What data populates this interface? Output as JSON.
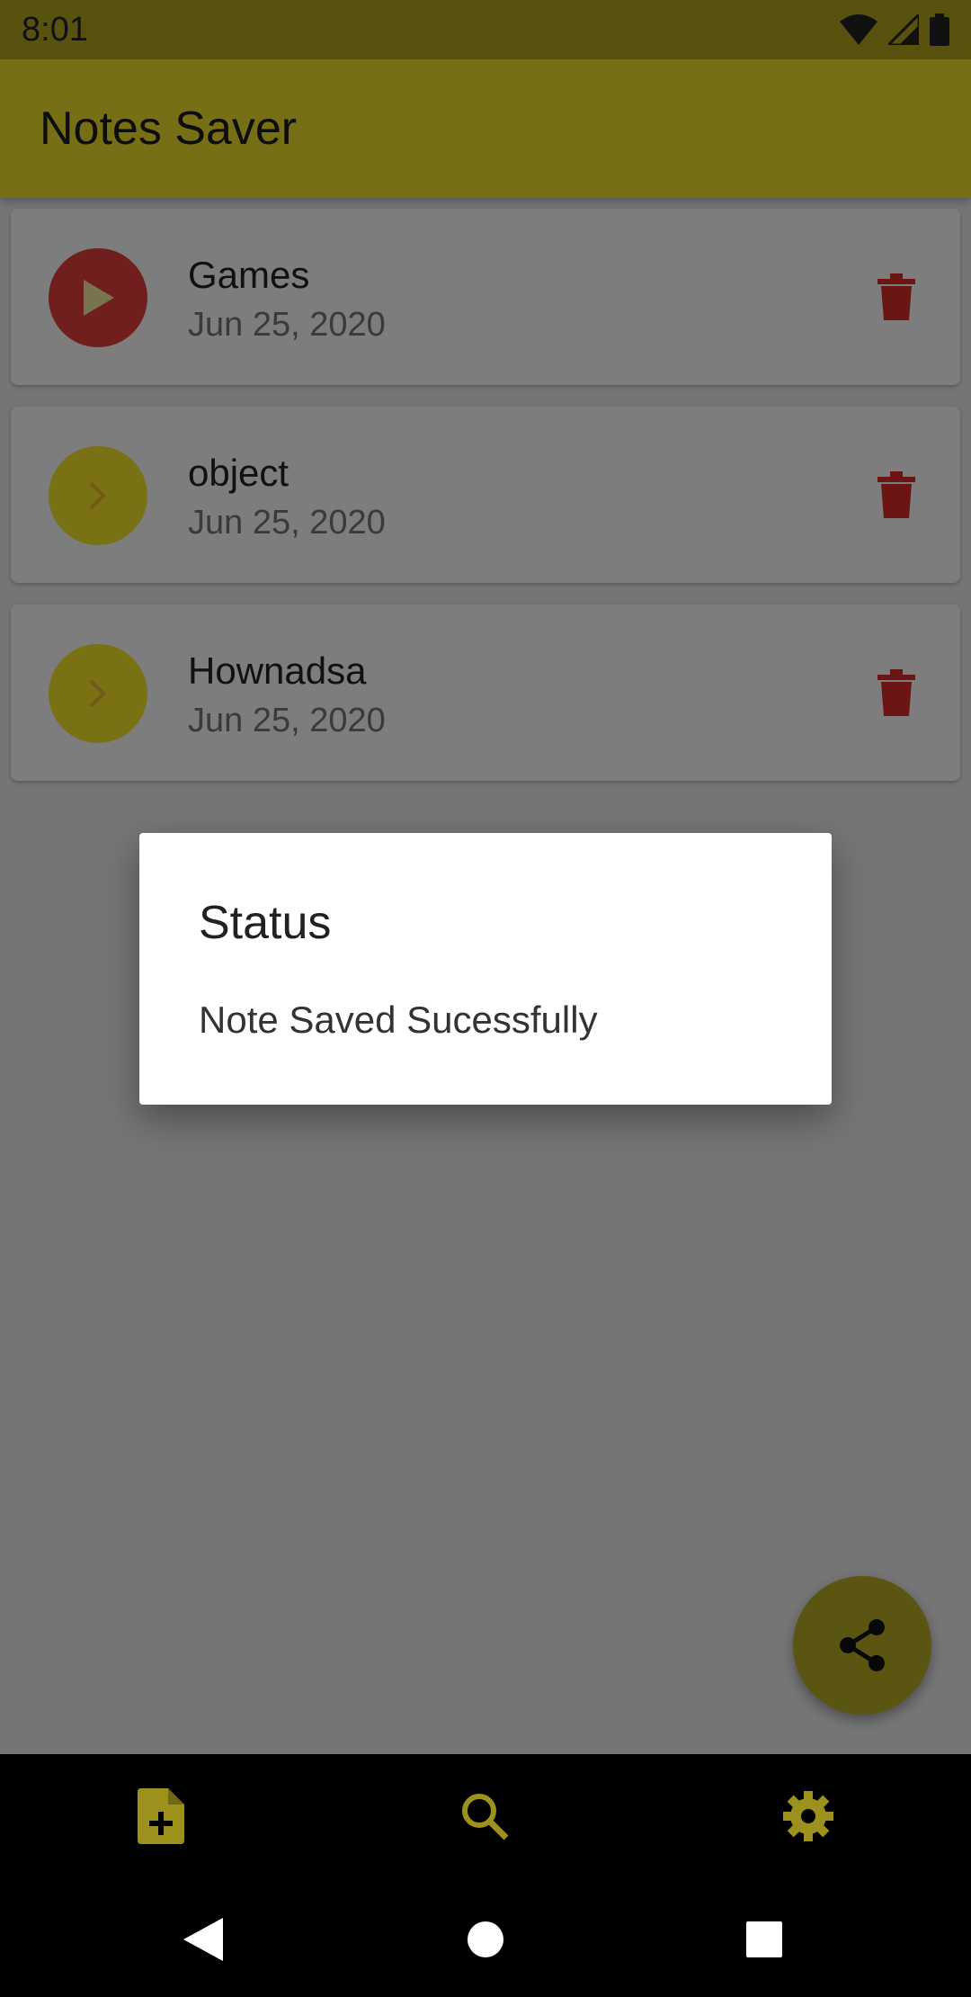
{
  "status_bar": {
    "time": "8:01",
    "icons": [
      "wifi-icon",
      "signal-icon",
      "battery-icon"
    ]
  },
  "app_bar": {
    "title": "Notes Saver"
  },
  "notes": [
    {
      "title": "Games",
      "date": "Jun 25, 2020",
      "avatar_icon": "play-icon",
      "avatar_color": "#e23c3c"
    },
    {
      "title": "object",
      "date": "Jun 25, 2020",
      "avatar_icon": "chevron-right-icon",
      "avatar_color": "#f2e52b"
    },
    {
      "title": "Hownadsa",
      "date": "Jun 25, 2020",
      "avatar_icon": "chevron-right-icon",
      "avatar_color": "#f2e52b"
    }
  ],
  "dialog": {
    "title": "Status",
    "message": "Note Saved Sucessfully"
  },
  "fab": {
    "icon": "share-icon"
  },
  "bottom_nav": [
    {
      "icon": "add-note-icon"
    },
    {
      "icon": "search-icon"
    },
    {
      "icon": "settings-icon"
    }
  ],
  "system_nav": [
    "back-icon",
    "home-icon",
    "recents-icon"
  ],
  "colors": {
    "accent": "#eede2a",
    "delete": "#d92b2b"
  }
}
